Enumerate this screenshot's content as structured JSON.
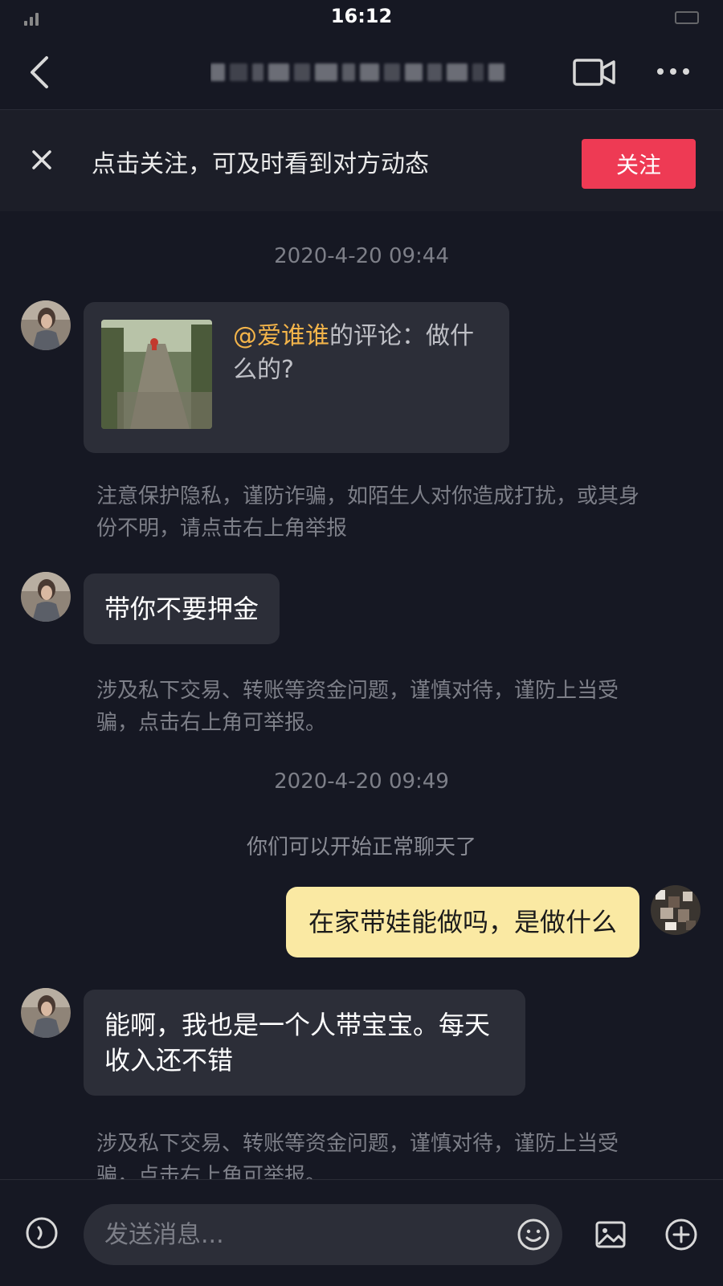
{
  "status_bar": {
    "time": "16:12"
  },
  "header": {
    "title": ""
  },
  "follow_banner": {
    "text": "点击关注，可及时看到对方动态",
    "button_label": "关注"
  },
  "messages": {
    "timestamp_1": "2020-4-20 09:44",
    "quote": {
      "mention": "@爱谁谁",
      "text": "的评论：做什么的?"
    },
    "notice_1": "注意保护隐私，谨防诈骗，如陌生人对你造成打扰，或其身份不明，请点击右上角举报",
    "msg_1": "带你不要押金",
    "notice_2": "涉及私下交易、转账等资金问题，谨慎对待，谨防上当受骗，点击右上角可举报。",
    "timestamp_2": "2020-4-20 09:49",
    "system": "你们可以开始正常聊天了",
    "msg_mine": "在家带娃能做吗，是做什么",
    "msg_2": "能啊，我也是一个人带宝宝。每天收入还不错",
    "notice_3": "涉及私下交易、转账等资金问题，谨慎对待，谨防上当受骗，点击右上角可举报。"
  },
  "input": {
    "placeholder": "发送消息..."
  },
  "colors": {
    "background": "#161823",
    "follow_button": "#ee3a54",
    "my_bubble": "#fae9a3",
    "mention": "#f3b44a"
  },
  "icons": [
    "back-icon",
    "video-call-icon",
    "more-icon",
    "close-icon",
    "voice-icon",
    "emoji-icon",
    "image-icon",
    "plus-icon"
  ]
}
